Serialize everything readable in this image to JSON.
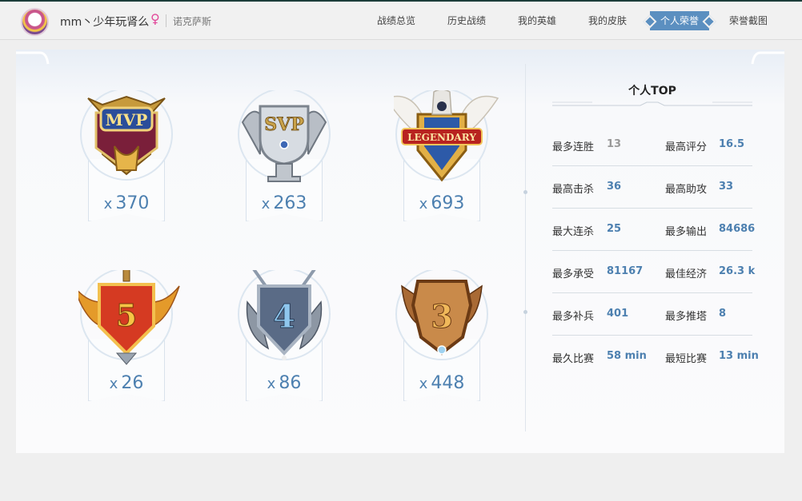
{
  "header": {
    "username": "mm丶少年玩肾么",
    "gender_symbol": "♀",
    "server": "诺克萨斯",
    "nav": [
      {
        "label": "战绩总览",
        "active": false
      },
      {
        "label": "历史战绩",
        "active": false
      },
      {
        "label": "我的英雄",
        "active": false
      },
      {
        "label": "我的皮肤",
        "active": false
      },
      {
        "label": "个人荣誉",
        "active": true
      },
      {
        "label": "荣誉截图",
        "active": false
      }
    ]
  },
  "badges": [
    {
      "name": "MVP",
      "count": "370",
      "prefix": "x"
    },
    {
      "name": "SVP",
      "count": "263",
      "prefix": "x"
    },
    {
      "name": "LEGENDARY",
      "count": "693",
      "prefix": "x"
    },
    {
      "name": "5",
      "count": "26",
      "prefix": "x"
    },
    {
      "name": "4",
      "count": "86",
      "prefix": "x"
    },
    {
      "name": "3",
      "count": "448",
      "prefix": "x"
    }
  ],
  "top": {
    "title": "个人TOP",
    "rows": [
      {
        "l1": "最多连胜",
        "v1": "13",
        "l2": "最高评分",
        "v2": "16.5"
      },
      {
        "l1": "最高击杀",
        "v1": "36",
        "l2": "最高助攻",
        "v2": "33"
      },
      {
        "l1": "最大连杀",
        "v1": "25",
        "l2": "最多输出",
        "v2": "84686"
      },
      {
        "l1": "最多承受",
        "v1": "81167",
        "l2": "最佳经济",
        "v2": "26.3 k"
      },
      {
        "l1": "最多补兵",
        "v1": "401",
        "l2": "最多推塔",
        "v2": "8"
      },
      {
        "l1": "最久比赛",
        "v1": "58 min",
        "l2": "最短比赛",
        "v2": "13 min"
      }
    ]
  },
  "colors": {
    "accent": "#5b8fc0",
    "value": "#4d80b0",
    "gender": "#e2489a"
  }
}
